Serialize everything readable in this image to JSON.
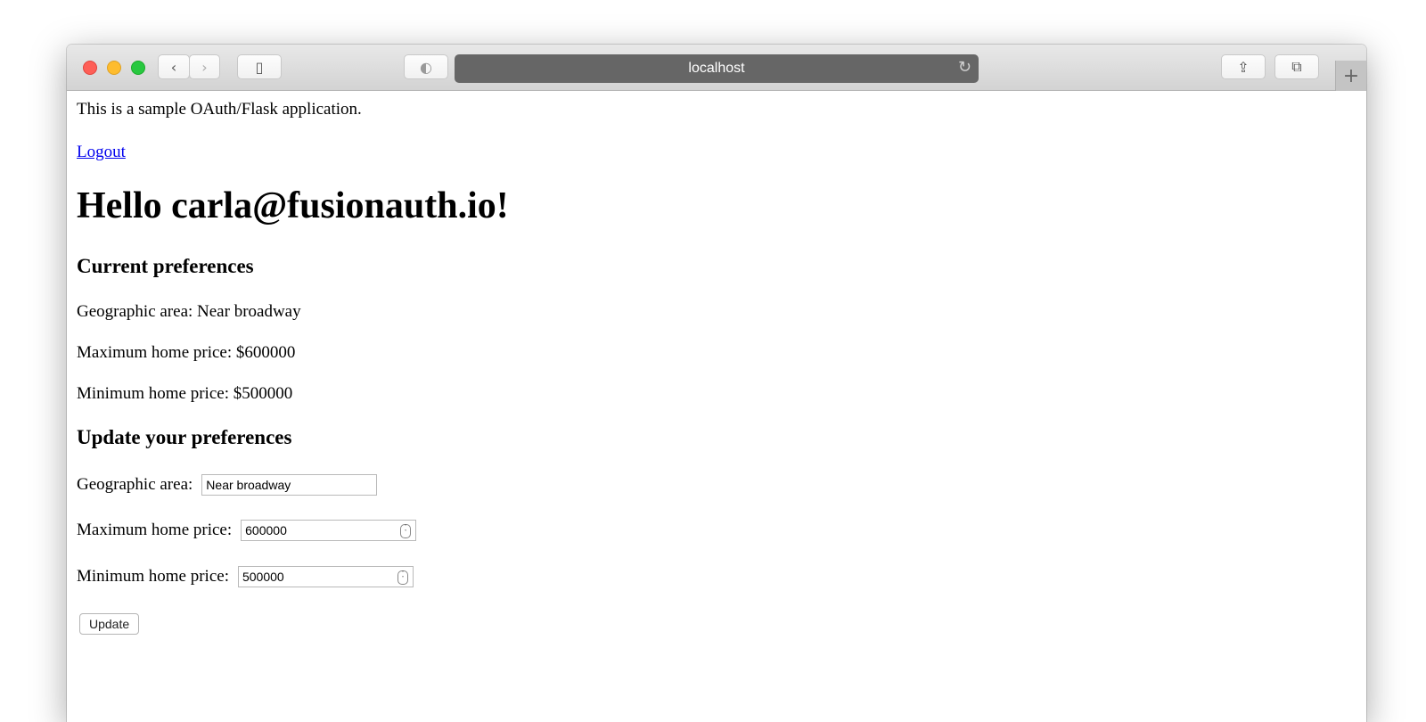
{
  "browser": {
    "url": "localhost",
    "icons": {
      "back": "chevron-left-icon",
      "forward": "chevron-right-icon",
      "sidebar": "sidebar-icon",
      "shield": "privacy-shield-icon",
      "reload": "reload-icon",
      "share": "share-icon",
      "tabs": "tab-overview-icon",
      "new_tab": "plus-icon"
    }
  },
  "page": {
    "intro": "This is a sample OAuth/Flask application.",
    "logout_label": "Logout",
    "greeting": "Hello carla@fusionauth.io!",
    "current": {
      "heading": "Current preferences",
      "geo": "Geographic area: Near broadway",
      "max": "Maximum home price: $600000",
      "min": "Minimum home price: $500000"
    },
    "form": {
      "heading": "Update your preferences",
      "geo_label": "Geographic area:",
      "geo_value": "Near broadway",
      "max_label": "Maximum home price:",
      "max_value": "600000",
      "min_label": "Minimum home price:",
      "min_value": "500000",
      "submit_label": "Update"
    }
  }
}
